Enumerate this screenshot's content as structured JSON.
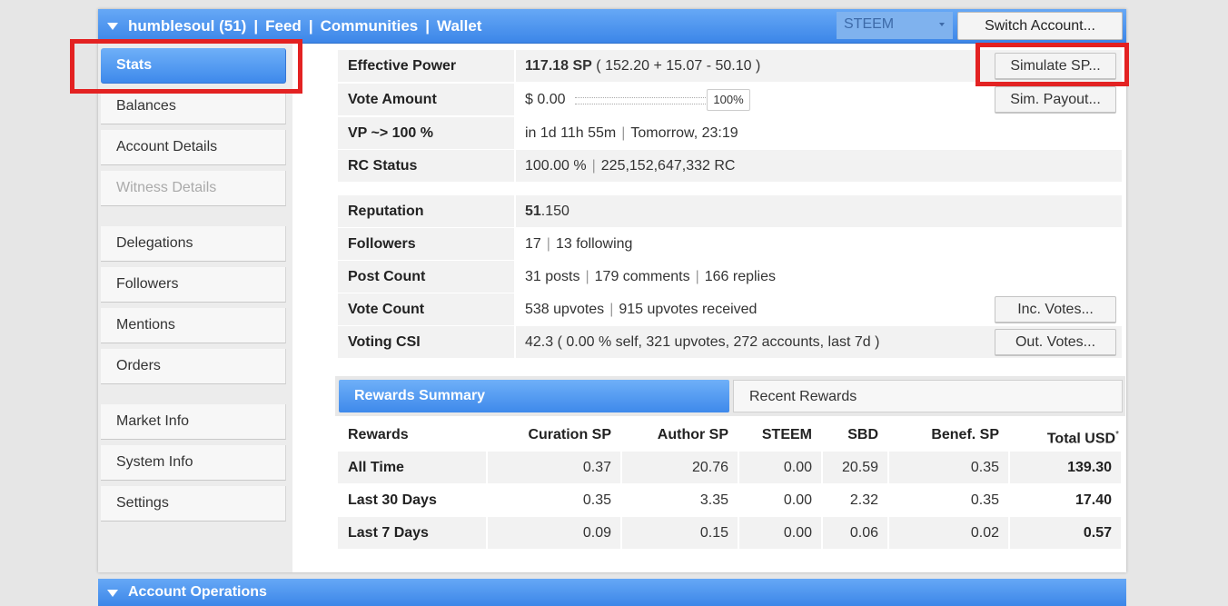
{
  "header": {
    "account": "humblesoul (51)",
    "nav": [
      "Feed",
      "Communities",
      "Wallet"
    ],
    "currency": "STEEM",
    "switch_account": "Switch Account..."
  },
  "sidebar": {
    "items": [
      {
        "label": "Stats",
        "state": "active"
      },
      {
        "label": "Balances",
        "state": "normal"
      },
      {
        "label": "Account Details",
        "state": "normal"
      },
      {
        "label": "Witness Details",
        "state": "disabled"
      },
      {
        "label": "Delegations",
        "state": "normal"
      },
      {
        "label": "Followers",
        "state": "normal"
      },
      {
        "label": "Mentions",
        "state": "normal"
      },
      {
        "label": "Orders",
        "state": "normal"
      },
      {
        "label": "Market Info",
        "state": "normal"
      },
      {
        "label": "System Info",
        "state": "normal"
      },
      {
        "label": "Settings",
        "state": "normal"
      }
    ]
  },
  "stats": {
    "effective_power": {
      "label": "Effective Power",
      "value_strong": "117.18 SP",
      "value_rest": " ( 152.20 + 15.07 - 50.10 )",
      "button": "Simulate SP..."
    },
    "vote_amount": {
      "label": "Vote Amount",
      "value": "$ 0.00",
      "slider_percent": "100%",
      "slider_fraction": 1.0,
      "button": "Sim. Payout..."
    },
    "vp": {
      "label": "VP ~> 100 %",
      "part1": "in 1d 11h 55m",
      "part2": "Tomorrow, 23:19"
    },
    "rc": {
      "label": "RC Status",
      "part1": "100.00 %",
      "part2": "225,152,647,332 RC"
    },
    "reputation": {
      "label": "Reputation",
      "whole": "51",
      "decimal": ".150"
    },
    "followers": {
      "label": "Followers",
      "part1": "17",
      "part2": "13 following"
    },
    "post_count": {
      "label": "Post Count",
      "part1": "31 posts",
      "part2": "179 comments",
      "part3": "166 replies"
    },
    "vote_count": {
      "label": "Vote Count",
      "part1": "538 upvotes",
      "part2": "915 upvotes received",
      "button": "Inc. Votes..."
    },
    "voting_csi": {
      "label": "Voting CSI",
      "value": "42.3 ( 0.00 % self, 321 upvotes, 272 accounts, last 7d )",
      "button": "Out. Votes..."
    }
  },
  "rewards": {
    "tabs": [
      "Rewards Summary",
      "Recent Rewards"
    ],
    "headers": [
      "Rewards",
      "Curation SP",
      "Author SP",
      "STEEM",
      "SBD",
      "Benef. SP",
      "Total USD"
    ],
    "footnote_mark": "*",
    "rows": [
      {
        "period": "All Time",
        "curation": "0.37",
        "author": "20.76",
        "steem": "0.00",
        "sbd": "20.59",
        "benef": "0.35",
        "total": "139.30"
      },
      {
        "period": "Last 30 Days",
        "curation": "0.35",
        "author": "3.35",
        "steem": "0.00",
        "sbd": "2.32",
        "benef": "0.35",
        "total": "17.40"
      },
      {
        "period": "Last 7 Days",
        "curation": "0.09",
        "author": "0.15",
        "steem": "0.00",
        "sbd": "0.06",
        "benef": "0.02",
        "total": "0.57"
      }
    ]
  },
  "bottom": {
    "title": "Account Operations"
  },
  "colors": {
    "accent": "#3e89eb",
    "highlight": "#e32222"
  }
}
